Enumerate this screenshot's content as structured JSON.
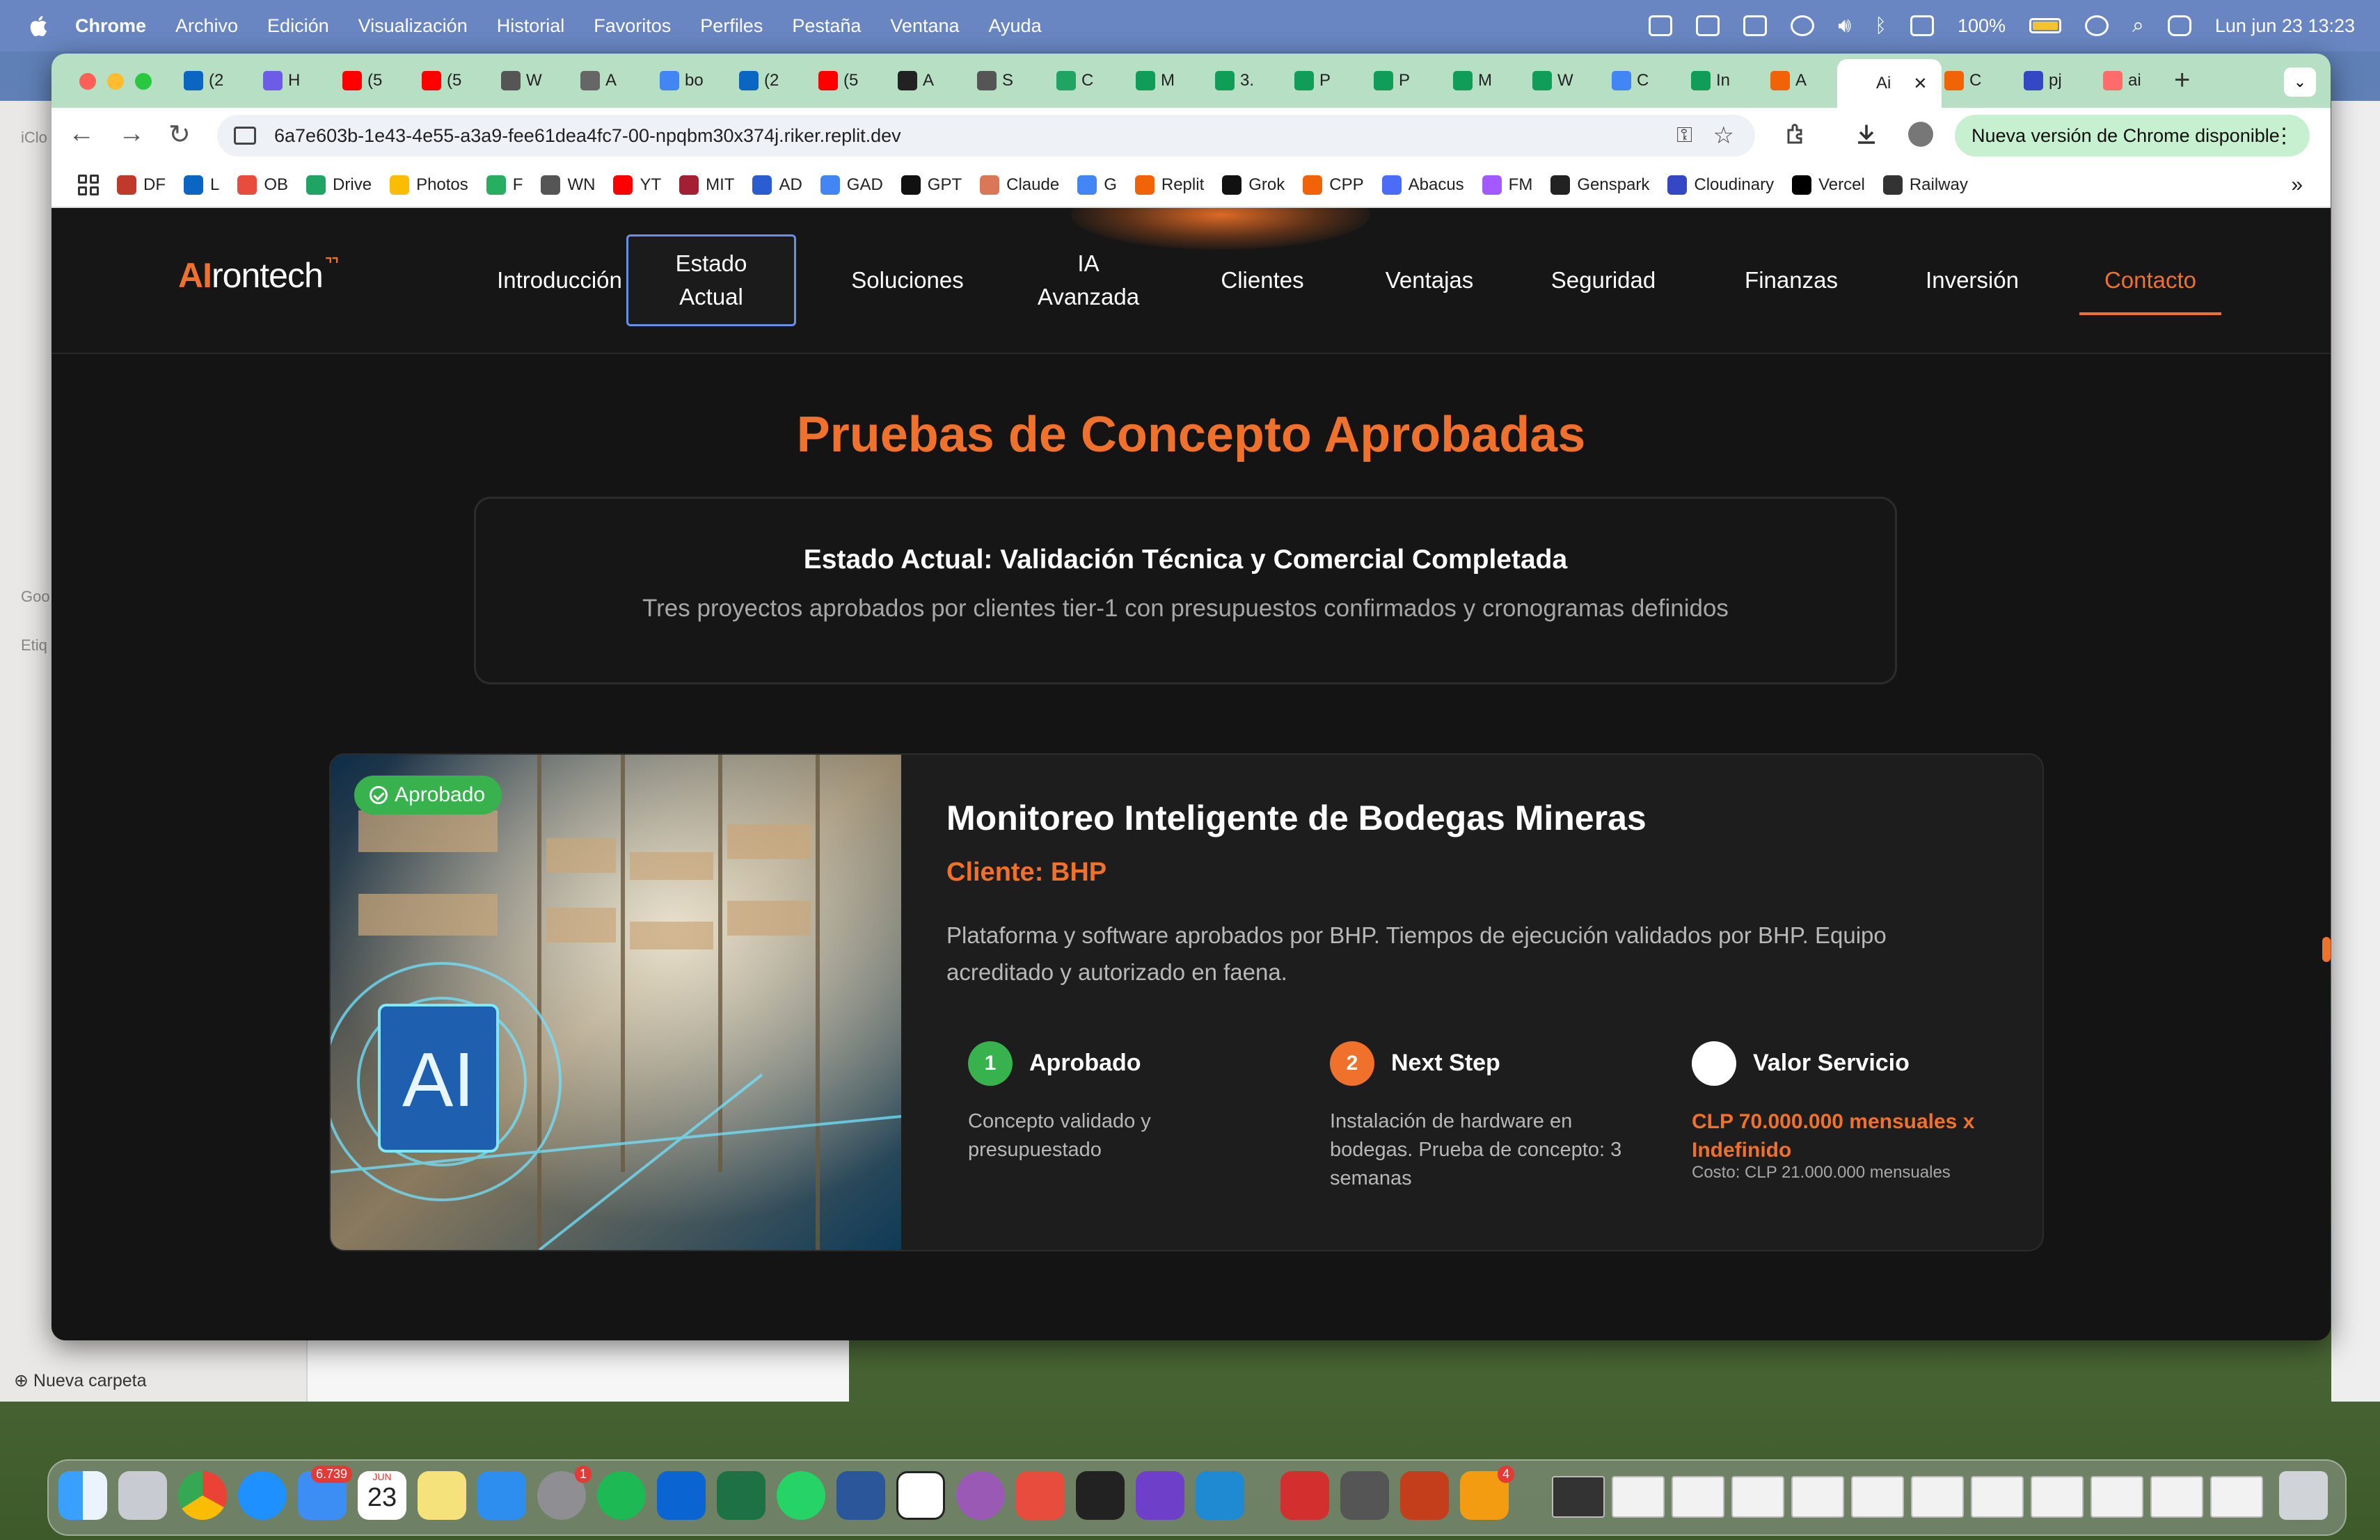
{
  "menubar": {
    "app": "Chrome",
    "items": [
      "Archivo",
      "Edición",
      "Visualización",
      "Historial",
      "Favoritos",
      "Perfiles",
      "Pestaña",
      "Ventana",
      "Ayuda"
    ],
    "battery": "100%",
    "datetime": "Lun jun 23  13:23"
  },
  "finder": {
    "sidebar": [
      "iClo",
      "Goo",
      "Etiq"
    ],
    "new_folder": "Nueva carpeta"
  },
  "tabs": [
    {
      "label": "(2",
      "color": "#0a66c2"
    },
    {
      "label": "H",
      "color": "#6c5ce7"
    },
    {
      "label": "(5",
      "color": "#ff0000"
    },
    {
      "label": "(5",
      "color": "#ff0000"
    },
    {
      "label": "W",
      "color": "#555555"
    },
    {
      "label": "A",
      "color": "#666666"
    },
    {
      "label": "bo",
      "color": "#4285f4"
    },
    {
      "label": "(2",
      "color": "#0a66c2"
    },
    {
      "label": "(5",
      "color": "#ff0000"
    },
    {
      "label": "A",
      "color": "#222222"
    },
    {
      "label": "S",
      "color": "#555555"
    },
    {
      "label": "C",
      "color": "#1fa463"
    },
    {
      "label": "M",
      "color": "#0f9d58"
    },
    {
      "label": "3.",
      "color": "#0f9d58"
    },
    {
      "label": "P",
      "color": "#0f9d58"
    },
    {
      "label": "P",
      "color": "#0f9d58"
    },
    {
      "label": "M",
      "color": "#0f9d58"
    },
    {
      "label": "W",
      "color": "#0f9d58"
    },
    {
      "label": "C",
      "color": "#4285f4"
    },
    {
      "label": "In",
      "color": "#0f9d58"
    },
    {
      "label": "A",
      "color": "#f26207"
    },
    {
      "label": "Ai",
      "color": "#ffffff",
      "active": true
    },
    {
      "label": "C",
      "color": "#f26207"
    },
    {
      "label": "pj",
      "color": "#3448c5"
    },
    {
      "label": "ai",
      "color": "#ff6b6b"
    }
  ],
  "toolbar": {
    "url": "6a7e603b-1e43-4e55-a3a9-fee61dea4fc7-00-npqbm30x374j.riker.replit.dev",
    "update_label": "Nueva versión de Chrome disponible"
  },
  "bookmarks": [
    {
      "label": "DF",
      "color": "#c0392b"
    },
    {
      "label": "L",
      "color": "#0a66c2"
    },
    {
      "label": "OB",
      "color": "#e74c3c"
    },
    {
      "label": "Drive",
      "color": "#1fa463"
    },
    {
      "label": "Photos",
      "color": "#fbbc04"
    },
    {
      "label": "F",
      "color": "#27ae60"
    },
    {
      "label": "WN",
      "color": "#555555"
    },
    {
      "label": "YT",
      "color": "#ff0000"
    },
    {
      "label": "MIT",
      "color": "#a31f34"
    },
    {
      "label": "AD",
      "color": "#2b5cd1"
    },
    {
      "label": "GAD",
      "color": "#4285f4"
    },
    {
      "label": "GPT",
      "color": "#111111"
    },
    {
      "label": "Claude",
      "color": "#d97757"
    },
    {
      "label": "G",
      "color": "#4285f4"
    },
    {
      "label": "Replit",
      "color": "#f26207"
    },
    {
      "label": "Grok",
      "color": "#111111"
    },
    {
      "label": "CPP",
      "color": "#f26207"
    },
    {
      "label": "Abacus",
      "color": "#4a6cf7"
    },
    {
      "label": "FM",
      "color": "#a259ff"
    },
    {
      "label": "Genspark",
      "color": "#222222"
    },
    {
      "label": "Cloudinary",
      "color": "#3448c5"
    },
    {
      "label": "Vercel",
      "color": "#000000"
    },
    {
      "label": "Railway",
      "color": "#333333"
    }
  ],
  "site": {
    "logo_ai": "AI",
    "logo_rest": "rontech",
    "nav": [
      {
        "label": "Introducción"
      },
      {
        "label": "Estado Actual"
      },
      {
        "label": "Soluciones"
      },
      {
        "label": "IA Avanzada"
      },
      {
        "label": "Clientes"
      },
      {
        "label": "Ventajas"
      },
      {
        "label": "Seguridad"
      },
      {
        "label": "Finanzas"
      },
      {
        "label": "Inversión"
      },
      {
        "label": "Contacto"
      }
    ],
    "title": "Pruebas de Concepto Aprobadas",
    "status_heading": "Estado Actual: Validación Técnica y Comercial Completada",
    "status_sub": "Tres proyectos aprobados por clientes tier-1 con presupuestos confirmados y cronogramas definidos",
    "card": {
      "badge": "Aprobado",
      "image_overlay": "AI",
      "title": "Monitoreo Inteligente de Bodegas Mineras",
      "client": "Cliente: BHP",
      "description": "Plataforma y software aprobados por BHP. Tiempos de ejecución validados por BHP. Equipo acreditado y autorizado en faena.",
      "steps": [
        {
          "num": "1",
          "label": "Aprobado",
          "text": "Concepto validado y presupuestado",
          "color": "#37b24d"
        },
        {
          "num": "2",
          "label": "Next Step",
          "text": "Instalación de hardware en bodegas. Prueba de concepto: 3 semanas",
          "color": "#f0712b"
        },
        {
          "num": "",
          "label": "Valor Servicio",
          "value": "CLP 70.000.000 mensuales x Indefinido",
          "cost": "Costo: CLP 21.000.000 mensuales",
          "color": "#ffffff"
        }
      ]
    }
  },
  "dock": {
    "mail_badge": "6.739",
    "calendar_month": "JUN",
    "calendar_day": "23",
    "settings_badge": "1",
    "apps_badge": "4"
  },
  "colors": {
    "accent": "#f0712b",
    "success": "#37b24d",
    "nav_focus": "#6b8ee8"
  }
}
